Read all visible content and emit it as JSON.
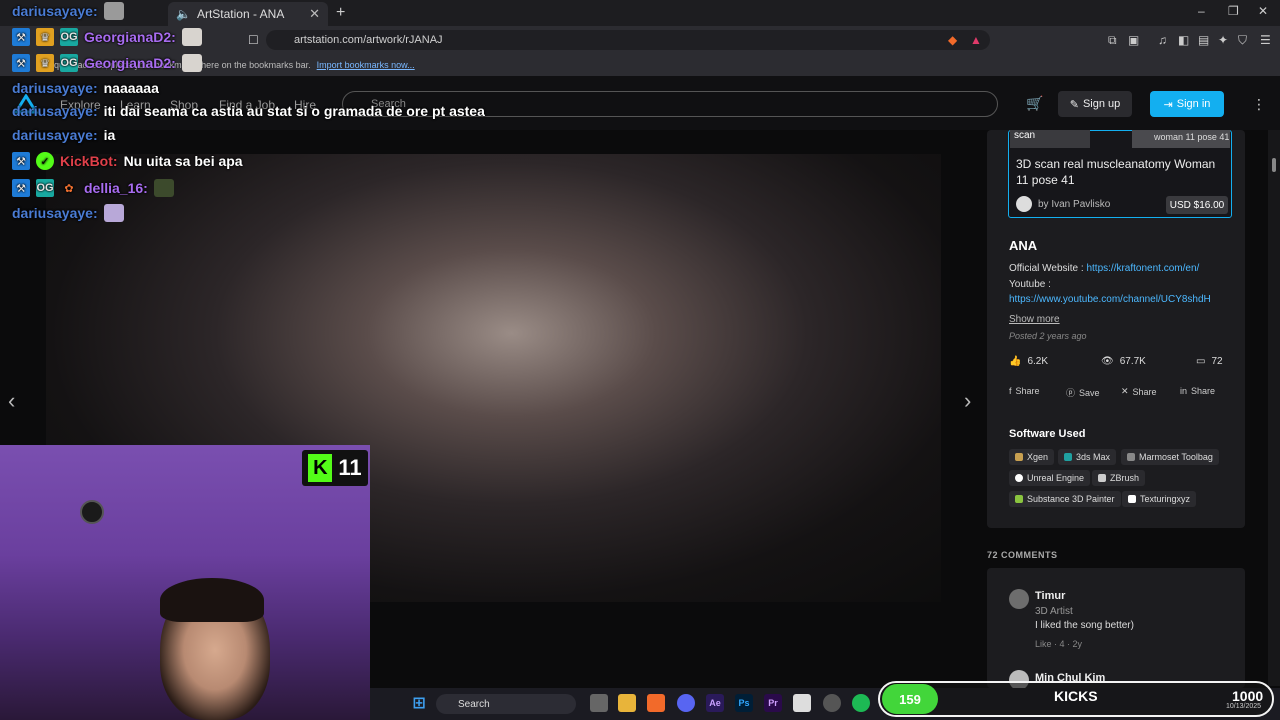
{
  "browser": {
    "tab_title": "ArtStation - ANA",
    "new_tab": "+",
    "window_controls": [
      "–",
      "❐",
      "✕"
    ],
    "url": "artstation.com/artwork/rJANAJ",
    "bookmarks_text": "For quick access, place your bookmarks here on the bookmarks bar.",
    "import_bookmarks": "Import bookmarks now..."
  },
  "site": {
    "nav": [
      "Explore",
      "Learn",
      "Shop",
      "Find a Job",
      "Hire"
    ],
    "search_placeholder": "Search",
    "signup_label": "Sign up",
    "signin_label": "Sign in"
  },
  "promo": {
    "thumb_left": "scan",
    "thumb_right": "woman 11 pose 41",
    "title": "3D scan real muscleanatomy Woman 11 pose 41",
    "author": "by Ivan Pavlisko",
    "price": "USD $16.00"
  },
  "artwork": {
    "title": "ANA",
    "website_label": "Official Website :",
    "website_url": "https://kraftonent.com/en/",
    "youtube_label": "Youtube :",
    "youtube_url": "https://www.youtube.com/channel/UCY8shdH",
    "show_more": "Show more",
    "posted": "Posted 2 years ago",
    "likes": "6.2K",
    "views": "67.7K",
    "comments_count": "72",
    "share_buttons": [
      "Share",
      "Save",
      "Share",
      "Share"
    ],
    "software_title": "Software Used",
    "software": [
      "Xgen",
      "3ds Max",
      "Marmoset Toolbag",
      "Unreal Engine",
      "ZBrush",
      "Substance 3D Painter",
      "Texturingxyz"
    ],
    "software_colors": [
      "#c8a050",
      "#1fa0a0",
      "#888888",
      "#ffffff",
      "#cccccc",
      "#8ac43f",
      "#ffffff"
    ]
  },
  "comments": {
    "header": "72 COMMENTS",
    "items": [
      {
        "name": "Timur",
        "role": "3D Artist",
        "text": "I liked the song better)",
        "meta": "Like · 4 · 2y"
      },
      {
        "name": "Min Chul Kim",
        "role": "",
        "text": "",
        "meta": ""
      }
    ]
  },
  "chat": [
    {
      "user": "dariusayaye:",
      "color": "#4a7cd4",
      "msg": ""
    },
    {
      "user": "GeorgianaD2:",
      "color": "#a86cf0",
      "msg": ""
    },
    {
      "user": "GeorgianaD2:",
      "color": "#a86cf0",
      "msg": ""
    },
    {
      "user": "dariusayaye:",
      "color": "#4a7cd4",
      "msg": "naaaaaa"
    },
    {
      "user": "dariusayaye:",
      "color": "#4a7cd4",
      "msg": "iti dai seama ca astia au stat si o gramada de ore pt astea"
    },
    {
      "user": "dariusayaye:",
      "color": "#4a7cd4",
      "msg": "ia"
    },
    {
      "user": "KickBot:",
      "color": "#e0404a",
      "msg": "Nu uita sa bei apa"
    },
    {
      "user": "dellia_16:",
      "color": "#a86cf0",
      "msg": ""
    },
    {
      "user": "dariusayaye:",
      "color": "#4a7cd4",
      "msg": ""
    }
  ],
  "overlay": {
    "kick_count": "11",
    "kicks_current": "159",
    "kicks_label": "KICKS",
    "kicks_goal": "1000",
    "kicks_progress": 0.159,
    "clock_date": "10/13/2025"
  },
  "taskbar": {
    "search": "Search",
    "apps": [
      "Ae",
      "Ps",
      "Pr"
    ]
  }
}
